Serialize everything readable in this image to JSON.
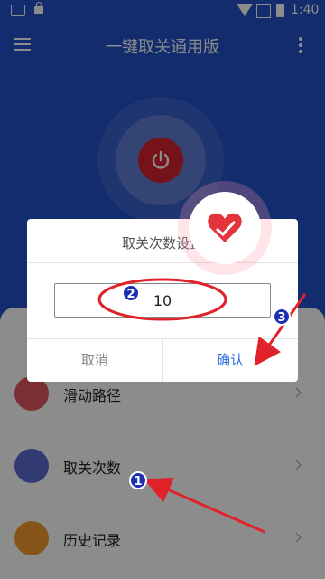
{
  "status_bar": {
    "time": "1:40"
  },
  "app_bar": {
    "title": "一键取关通用版"
  },
  "menu_items": [
    {
      "label": "滑动路径",
      "icon": "touch-hand-icon",
      "color": "#e0545f"
    },
    {
      "label": "取关次数",
      "icon": "counter-123-icon",
      "color": "#5b6bd3"
    },
    {
      "label": "历史记录",
      "icon": "clock-icon",
      "color": "#f29a2e"
    }
  ],
  "dialog": {
    "title": "取关次数设置",
    "value": "10",
    "cancel_label": "取消",
    "confirm_label": "确认"
  },
  "annotations": {
    "badge1": "1",
    "badge2": "2",
    "badge3": "3"
  },
  "colors": {
    "primary": "#2450c8",
    "power": "#d7232c",
    "accent": "#2f6fe0",
    "annotation": "#e0222a"
  }
}
